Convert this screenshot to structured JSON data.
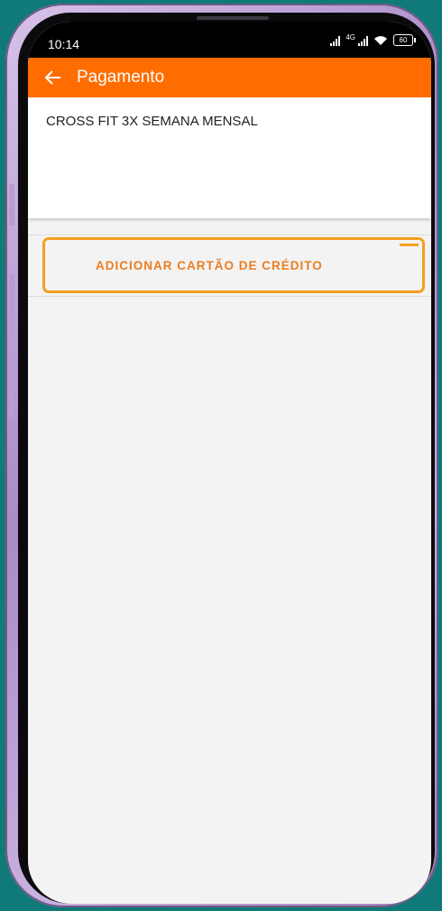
{
  "status_bar": {
    "time": "10:14",
    "network": "4G",
    "battery": "60"
  },
  "app_bar": {
    "title": "Pagamento"
  },
  "plan": {
    "name": "CROSS FIT 3X SEMANA MENSAL"
  },
  "actions": {
    "add_card_label": "ADICIONAR CARTÃO DE CRÉDITO"
  },
  "colors": {
    "accent": "#ff6d00",
    "highlight": "#f5a020",
    "label": "#ec7d1f",
    "background": "#0f7a78"
  }
}
